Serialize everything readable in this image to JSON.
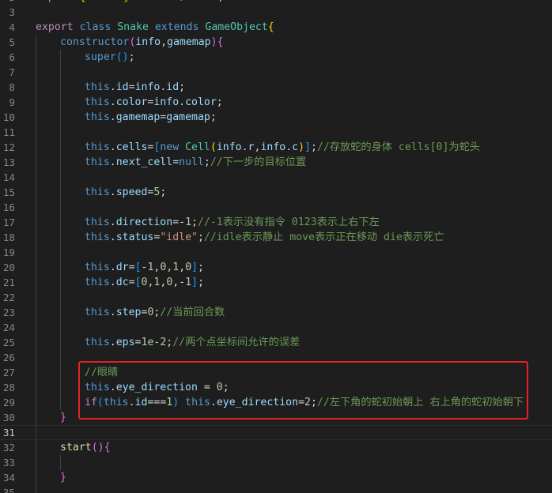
{
  "editor": {
    "lines": [
      {
        "n": "3",
        "indent": 0,
        "tokens": [
          {
            "t": "import ",
            "c": "kw2"
          },
          {
            "t": "{ ",
            "c": "br1"
          },
          {
            "t": "Cell",
            "c": "prop"
          },
          {
            "t": " } ",
            "c": "br1"
          },
          {
            "t": "from ",
            "c": "kw2"
          },
          {
            "t": "'./Cell'",
            "c": "str"
          },
          {
            "t": ";",
            "c": "pun"
          }
        ]
      },
      {
        "n": "3",
        "indent": 0,
        "tokens": []
      },
      {
        "n": "4",
        "indent": 0,
        "tokens": [
          {
            "t": "export ",
            "c": "kw2"
          },
          {
            "t": "class ",
            "c": "kw"
          },
          {
            "t": "Snake ",
            "c": "cls"
          },
          {
            "t": "extends ",
            "c": "kw"
          },
          {
            "t": "GameObject",
            "c": "cls"
          },
          {
            "t": "{",
            "c": "br1"
          }
        ]
      },
      {
        "n": "5",
        "indent": 1,
        "tokens": [
          {
            "t": "constructor",
            "c": "kw"
          },
          {
            "t": "(",
            "c": "br2"
          },
          {
            "t": "info",
            "c": "prop"
          },
          {
            "t": ",",
            "c": "pun"
          },
          {
            "t": "gamemap",
            "c": "prop"
          },
          {
            "t": ")",
            "c": "br2"
          },
          {
            "t": "{",
            "c": "br2"
          }
        ]
      },
      {
        "n": "6",
        "indent": 2,
        "tokens": [
          {
            "t": "super",
            "c": "kw"
          },
          {
            "t": "()",
            "c": "br3"
          },
          {
            "t": ";",
            "c": "pun"
          }
        ]
      },
      {
        "n": "7",
        "indent": 2,
        "tokens": []
      },
      {
        "n": "8",
        "indent": 2,
        "tokens": [
          {
            "t": "this",
            "c": "this"
          },
          {
            "t": ".",
            "c": "pun"
          },
          {
            "t": "id",
            "c": "prop"
          },
          {
            "t": "=",
            "c": "pun"
          },
          {
            "t": "info",
            "c": "prop"
          },
          {
            "t": ".",
            "c": "pun"
          },
          {
            "t": "id",
            "c": "prop"
          },
          {
            "t": ";",
            "c": "pun"
          }
        ]
      },
      {
        "n": "9",
        "indent": 2,
        "tokens": [
          {
            "t": "this",
            "c": "this"
          },
          {
            "t": ".",
            "c": "pun"
          },
          {
            "t": "color",
            "c": "prop"
          },
          {
            "t": "=",
            "c": "pun"
          },
          {
            "t": "info",
            "c": "prop"
          },
          {
            "t": ".",
            "c": "pun"
          },
          {
            "t": "color",
            "c": "prop"
          },
          {
            "t": ";",
            "c": "pun"
          }
        ]
      },
      {
        "n": "10",
        "indent": 2,
        "tokens": [
          {
            "t": "this",
            "c": "this"
          },
          {
            "t": ".",
            "c": "pun"
          },
          {
            "t": "gamemap",
            "c": "prop"
          },
          {
            "t": "=",
            "c": "pun"
          },
          {
            "t": "gamemap",
            "c": "prop"
          },
          {
            "t": ";",
            "c": "pun"
          }
        ]
      },
      {
        "n": "11",
        "indent": 2,
        "tokens": []
      },
      {
        "n": "12",
        "indent": 2,
        "tokens": [
          {
            "t": "this",
            "c": "this"
          },
          {
            "t": ".",
            "c": "pun"
          },
          {
            "t": "cells",
            "c": "prop"
          },
          {
            "t": "=",
            "c": "pun"
          },
          {
            "t": "[",
            "c": "br3"
          },
          {
            "t": "new ",
            "c": "kw"
          },
          {
            "t": "Cell",
            "c": "cls"
          },
          {
            "t": "(",
            "c": "br1"
          },
          {
            "t": "info",
            "c": "prop"
          },
          {
            "t": ".",
            "c": "pun"
          },
          {
            "t": "r",
            "c": "prop"
          },
          {
            "t": ",",
            "c": "pun"
          },
          {
            "t": "info",
            "c": "prop"
          },
          {
            "t": ".",
            "c": "pun"
          },
          {
            "t": "c",
            "c": "prop"
          },
          {
            "t": ")",
            "c": "br1"
          },
          {
            "t": "]",
            "c": "br3"
          },
          {
            "t": ";",
            "c": "pun"
          },
          {
            "t": "//存放蛇的身体 cells[0]为蛇头",
            "c": "com"
          }
        ]
      },
      {
        "n": "13",
        "indent": 2,
        "tokens": [
          {
            "t": "this",
            "c": "this"
          },
          {
            "t": ".",
            "c": "pun"
          },
          {
            "t": "next_cell",
            "c": "prop"
          },
          {
            "t": "=",
            "c": "pun"
          },
          {
            "t": "null",
            "c": "kw"
          },
          {
            "t": ";",
            "c": "pun"
          },
          {
            "t": "//下一步的目标位置",
            "c": "com"
          }
        ]
      },
      {
        "n": "14",
        "indent": 2,
        "tokens": []
      },
      {
        "n": "15",
        "indent": 2,
        "tokens": [
          {
            "t": "this",
            "c": "this"
          },
          {
            "t": ".",
            "c": "pun"
          },
          {
            "t": "speed",
            "c": "prop"
          },
          {
            "t": "=",
            "c": "pun"
          },
          {
            "t": "5",
            "c": "num"
          },
          {
            "t": ";",
            "c": "pun"
          }
        ]
      },
      {
        "n": "16",
        "indent": 2,
        "tokens": []
      },
      {
        "n": "17",
        "indent": 2,
        "tokens": [
          {
            "t": "this",
            "c": "this"
          },
          {
            "t": ".",
            "c": "pun"
          },
          {
            "t": "direction",
            "c": "prop"
          },
          {
            "t": "=-",
            "c": "pun"
          },
          {
            "t": "1",
            "c": "num"
          },
          {
            "t": ";",
            "c": "pun"
          },
          {
            "t": "//-1表示没有指令 0123表示上右下左",
            "c": "com"
          }
        ]
      },
      {
        "n": "18",
        "indent": 2,
        "tokens": [
          {
            "t": "this",
            "c": "this"
          },
          {
            "t": ".",
            "c": "pun"
          },
          {
            "t": "status",
            "c": "prop"
          },
          {
            "t": "=",
            "c": "pun"
          },
          {
            "t": "\"idle\"",
            "c": "str"
          },
          {
            "t": ";",
            "c": "pun"
          },
          {
            "t": "//idle表示静止 move表示正在移动 die表示死亡",
            "c": "com"
          }
        ]
      },
      {
        "n": "19",
        "indent": 2,
        "tokens": []
      },
      {
        "n": "20",
        "indent": 2,
        "tokens": [
          {
            "t": "this",
            "c": "this"
          },
          {
            "t": ".",
            "c": "pun"
          },
          {
            "t": "dr",
            "c": "prop"
          },
          {
            "t": "=",
            "c": "pun"
          },
          {
            "t": "[",
            "c": "br3"
          },
          {
            "t": "-",
            "c": "pun"
          },
          {
            "t": "1",
            "c": "num"
          },
          {
            "t": ",",
            "c": "pun"
          },
          {
            "t": "0",
            "c": "num"
          },
          {
            "t": ",",
            "c": "pun"
          },
          {
            "t": "1",
            "c": "num"
          },
          {
            "t": ",",
            "c": "pun"
          },
          {
            "t": "0",
            "c": "num"
          },
          {
            "t": "]",
            "c": "br3"
          },
          {
            "t": ";",
            "c": "pun"
          }
        ]
      },
      {
        "n": "21",
        "indent": 2,
        "tokens": [
          {
            "t": "this",
            "c": "this"
          },
          {
            "t": ".",
            "c": "pun"
          },
          {
            "t": "dc",
            "c": "prop"
          },
          {
            "t": "=",
            "c": "pun"
          },
          {
            "t": "[",
            "c": "br3"
          },
          {
            "t": "0",
            "c": "num"
          },
          {
            "t": ",",
            "c": "pun"
          },
          {
            "t": "1",
            "c": "num"
          },
          {
            "t": ",",
            "c": "pun"
          },
          {
            "t": "0",
            "c": "num"
          },
          {
            "t": ",-",
            "c": "pun"
          },
          {
            "t": "1",
            "c": "num"
          },
          {
            "t": "]",
            "c": "br3"
          },
          {
            "t": ";",
            "c": "pun"
          }
        ]
      },
      {
        "n": "22",
        "indent": 2,
        "tokens": []
      },
      {
        "n": "23",
        "indent": 2,
        "tokens": [
          {
            "t": "this",
            "c": "this"
          },
          {
            "t": ".",
            "c": "pun"
          },
          {
            "t": "step",
            "c": "prop"
          },
          {
            "t": "=",
            "c": "pun"
          },
          {
            "t": "0",
            "c": "num"
          },
          {
            "t": ";",
            "c": "pun"
          },
          {
            "t": "//当前回合数",
            "c": "com"
          }
        ]
      },
      {
        "n": "24",
        "indent": 2,
        "tokens": []
      },
      {
        "n": "25",
        "indent": 2,
        "tokens": [
          {
            "t": "this",
            "c": "this"
          },
          {
            "t": ".",
            "c": "pun"
          },
          {
            "t": "eps",
            "c": "prop"
          },
          {
            "t": "=",
            "c": "pun"
          },
          {
            "t": "1e-2",
            "c": "num"
          },
          {
            "t": ";",
            "c": "pun"
          },
          {
            "t": "//两个点坐标间允许的误差",
            "c": "com"
          }
        ]
      },
      {
        "n": "26",
        "indent": 2,
        "tokens": []
      },
      {
        "n": "27",
        "indent": 2,
        "tokens": [
          {
            "t": "//眼睛",
            "c": "com"
          }
        ]
      },
      {
        "n": "28",
        "indent": 2,
        "tokens": [
          {
            "t": "this",
            "c": "this"
          },
          {
            "t": ".",
            "c": "pun"
          },
          {
            "t": "eye_direction",
            "c": "prop"
          },
          {
            "t": " = ",
            "c": "pun"
          },
          {
            "t": "0",
            "c": "num"
          },
          {
            "t": ";",
            "c": "pun"
          }
        ]
      },
      {
        "n": "29",
        "indent": 2,
        "tokens": [
          {
            "t": "if",
            "c": "kw2"
          },
          {
            "t": "(",
            "c": "br3"
          },
          {
            "t": "this",
            "c": "this"
          },
          {
            "t": ".",
            "c": "pun"
          },
          {
            "t": "id",
            "c": "prop"
          },
          {
            "t": "===",
            "c": "pun"
          },
          {
            "t": "1",
            "c": "num"
          },
          {
            "t": ") ",
            "c": "br3"
          },
          {
            "t": "this",
            "c": "this"
          },
          {
            "t": ".",
            "c": "pun"
          },
          {
            "t": "eye_direction",
            "c": "prop"
          },
          {
            "t": "=",
            "c": "pun"
          },
          {
            "t": "2",
            "c": "num"
          },
          {
            "t": ";",
            "c": "pun"
          },
          {
            "t": "//左下角的蛇初始朝上 右上角的蛇初始朝下",
            "c": "com"
          }
        ]
      },
      {
        "n": "30",
        "indent": 1,
        "tokens": [
          {
            "t": "}",
            "c": "br2"
          }
        ]
      },
      {
        "n": "31",
        "indent": 1,
        "current": true,
        "tokens": []
      },
      {
        "n": "32",
        "indent": 1,
        "tokens": [
          {
            "t": "start",
            "c": "fn"
          },
          {
            "t": "()",
            "c": "br2"
          },
          {
            "t": "{",
            "c": "br2"
          }
        ]
      },
      {
        "n": "33",
        "indent": 2,
        "tokens": []
      },
      {
        "n": "34",
        "indent": 1,
        "tokens": [
          {
            "t": "}",
            "c": "br2"
          }
        ]
      },
      {
        "n": "35",
        "indent": 1,
        "tokens": []
      }
    ]
  }
}
